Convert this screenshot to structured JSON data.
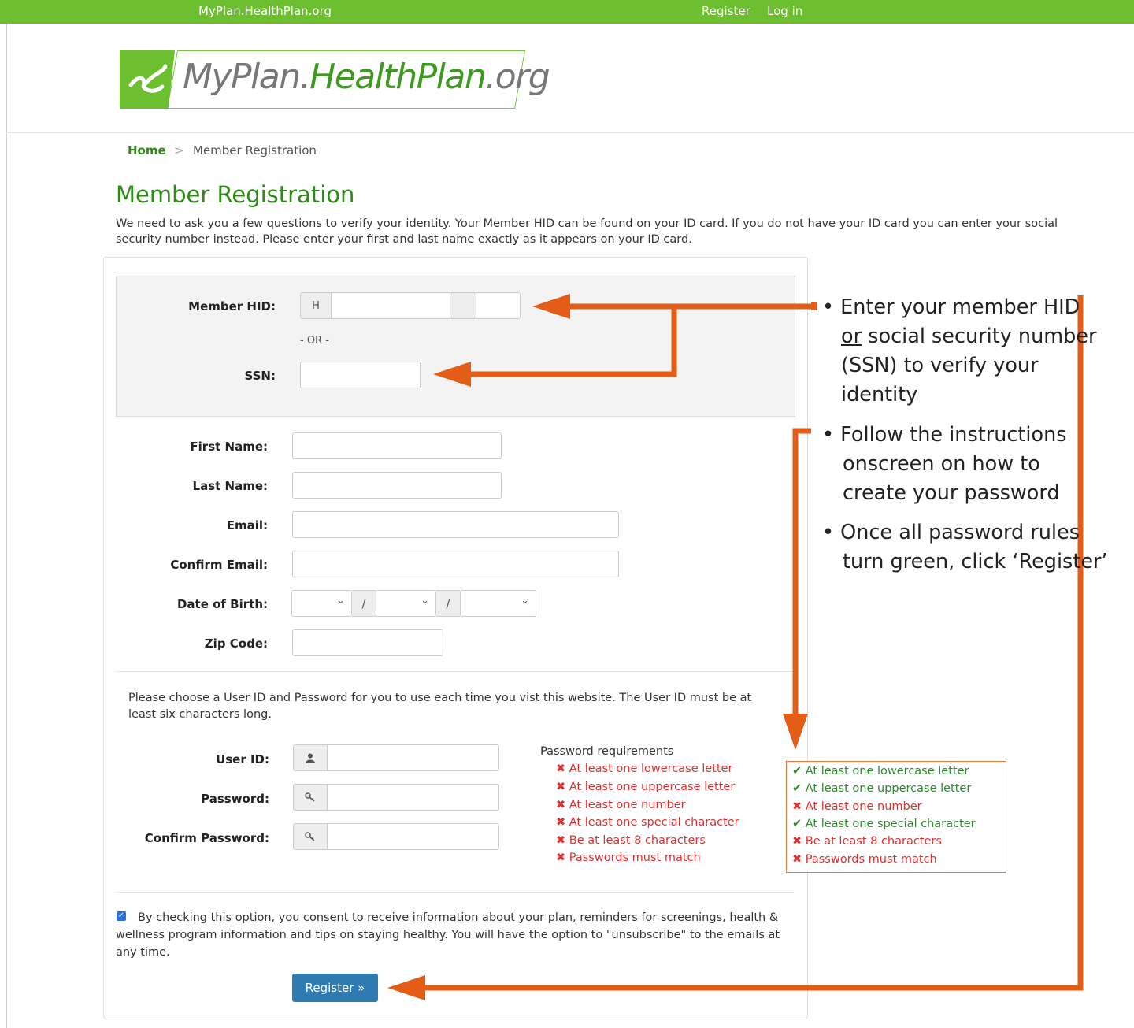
{
  "topbar": {
    "site": "MyPlan.HealthPlan.org",
    "register": "Register",
    "login": "Log in"
  },
  "logo": {
    "part1": "MyPlan.",
    "part2": "HealthPlan",
    "part3": ".org"
  },
  "breadcrumb": {
    "home": "Home",
    "separator": ">",
    "current": "Member Registration"
  },
  "page": {
    "title": "Member Registration",
    "intro": "We need to ask you a few questions to verify your identity. Your Member HID can be found on your ID card. If you do not have your ID card you can enter your social security number instead. Please enter your first and last name exactly as it appears on your ID card."
  },
  "identity": {
    "hid_label": "Member HID:",
    "hid_prefix": "H",
    "or": "- OR -",
    "ssn_label": "SSN:"
  },
  "fields": {
    "first_name": "First Name:",
    "last_name": "Last Name:",
    "email": "Email:",
    "confirm_email": "Confirm Email:",
    "dob": "Date of Birth:",
    "dob_sep": "/",
    "zip": "Zip Code:"
  },
  "account": {
    "instructions": "Please choose a User ID and Password for you to use each time you vist this website. The User ID must be at least six characters long.",
    "user_id": "User ID:",
    "password": "Password:",
    "confirm_password": "Confirm Password:"
  },
  "requirements": {
    "title": "Password requirements",
    "items": [
      "At least one lowercase letter",
      "At least one uppercase letter",
      "At least one number",
      "At least one special character",
      "Be at least 8 characters",
      "Passwords must match"
    ]
  },
  "requirements_example": {
    "items": [
      {
        "text": "At least one lowercase letter",
        "met": true
      },
      {
        "text": "At least one uppercase letter",
        "met": true
      },
      {
        "text": "At least one number",
        "met": false
      },
      {
        "text": "At least one special character",
        "met": true
      },
      {
        "text": "Be at least 8 characters",
        "met": false
      },
      {
        "text": "Passwords must match",
        "met": false
      }
    ]
  },
  "consent": {
    "checked": true,
    "text": "By checking this option, you consent to receive information about your plan, reminders for screenings, health & wellness program information and tips on staying healthy. You will have the option to \"unsubscribe\" to the emails at any time."
  },
  "register_button": "Register »",
  "notes": {
    "n1_line1": "Enter your member HID",
    "n1_or": "or",
    "n1_line2_rest": " social security number",
    "n1_line3": "(SSN) to verify your",
    "n1_line4": "identity",
    "n2_line1": "Follow the instructions",
    "n2_line2": "onscreen on how to",
    "n2_line3": "create your password",
    "n3_line1": "Once all password rules",
    "n3_line2": "turn green, click ‘Register’"
  },
  "colors": {
    "brand_green": "#6cbf2f",
    "heading_green": "#2d8a17",
    "arrow_orange": "#e35d17",
    "error_red": "#e0302f",
    "ok_green": "#2f8a30",
    "button_blue": "#2d7bb0"
  }
}
